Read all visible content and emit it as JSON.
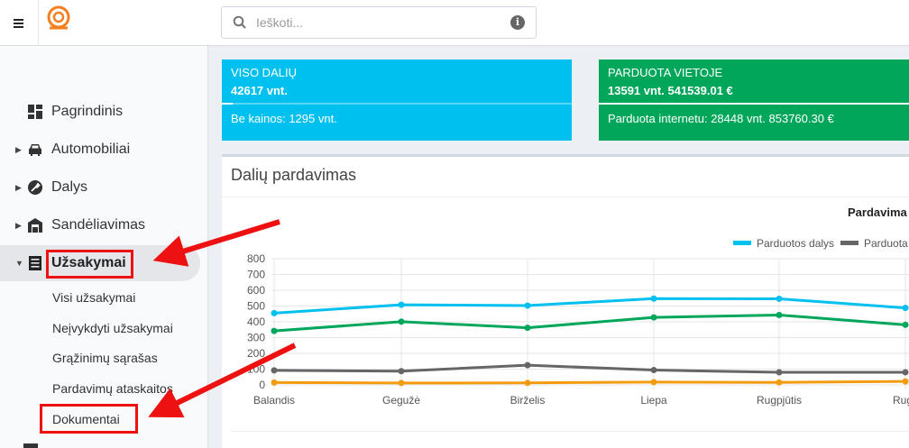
{
  "search": {
    "placeholder": "Ieškoti..."
  },
  "sidebar": {
    "items": [
      {
        "label": "Pagrindinis",
        "icon": "dashboard-icon"
      },
      {
        "label": "Automobiliai",
        "icon": "car-icon"
      },
      {
        "label": "Dalys",
        "icon": "wrench-icon"
      },
      {
        "label": "Sandėliavimas",
        "icon": "warehouse-icon"
      },
      {
        "label": "Užsakymai",
        "icon": "list-icon"
      }
    ],
    "subitems": [
      {
        "label": "Visi užsakymai"
      },
      {
        "label": "Neįvykdyti užsakymai"
      },
      {
        "label": "Grąžinimų sąrašas"
      },
      {
        "label": "Pardavimų ataskaitos"
      },
      {
        "label": "Dokumentai"
      }
    ]
  },
  "cards": {
    "total": {
      "title": "VISO DALIŲ",
      "value": "42617 vnt.",
      "footer": "Be kainos: 1295 vnt.",
      "progress": 0.03
    },
    "sold": {
      "title": "PARDUOTA VIETOJE",
      "value": "13591 vnt. 541539.01 €",
      "footer": "Parduota internetu: 28448 vnt. 853760.30 €",
      "progress": 1.0
    }
  },
  "panel": {
    "title": "Dalių pardavimas"
  },
  "chart_data": {
    "type": "line",
    "title": "Pardavima",
    "categories": [
      "Balandis",
      "Gegužė",
      "Birželis",
      "Liepa",
      "Rugpjūtis",
      "Rugs"
    ],
    "ylim": [
      0,
      800
    ],
    "yticks": [
      "0",
      "100",
      "200",
      "300",
      "400",
      "500",
      "600",
      "700",
      "800"
    ],
    "legend": [
      "Parduotos dalys",
      "Parduota v"
    ],
    "legend_placement": "top-right",
    "grid": true,
    "series": [
      {
        "name": "Parduotos dalys",
        "color": "#00c0ef",
        "values": [
          455,
          508,
          503,
          547,
          546,
          488
        ]
      },
      {
        "name": "",
        "color": "#00a65a",
        "values": [
          342,
          401,
          362,
          428,
          443,
          381
        ]
      },
      {
        "name": "Parduota v",
        "color": "#666666",
        "values": [
          92,
          87,
          125,
          94,
          80,
          80
        ]
      },
      {
        "name": "",
        "color": "#f39c12",
        "values": [
          15,
          12,
          13,
          18,
          16,
          22
        ]
      }
    ]
  },
  "colors": {
    "annotation": "#ee1111",
    "logo": "#f47f20"
  }
}
